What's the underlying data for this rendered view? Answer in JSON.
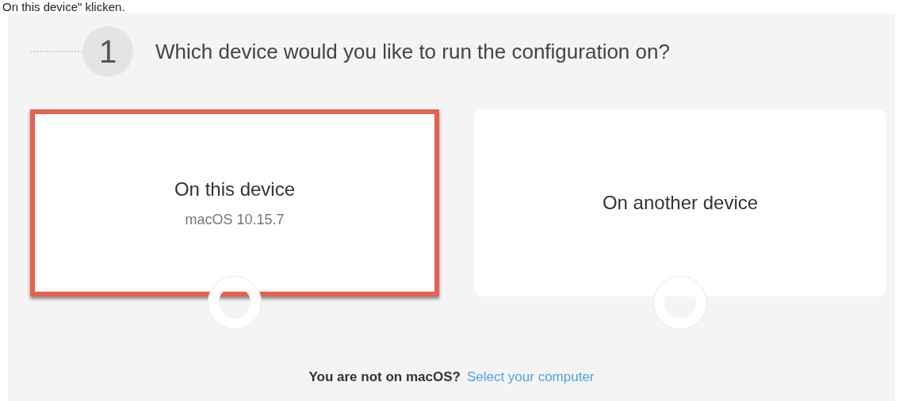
{
  "caption": "On this device\" klicken.",
  "step": {
    "number": "1",
    "question": "Which device would you like to run the configuration on?"
  },
  "options": [
    {
      "title": "On this device",
      "subtitle": "macOS 10.15.7",
      "selected": true
    },
    {
      "title": "On another device",
      "selected": false
    }
  ],
  "footer": {
    "text": "You are not on macOS?",
    "link": "Select your computer"
  }
}
